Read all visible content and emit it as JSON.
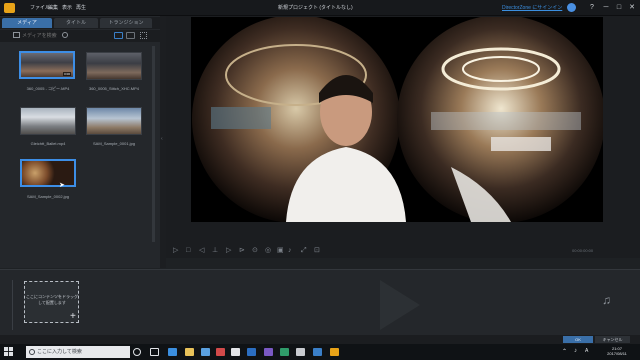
{
  "titlebar": {
    "menus": [
      "ファイル",
      "編集",
      "表示",
      "再生"
    ],
    "title": "新規プロジェクト (タイトルなし)",
    "director_zone": "DirectorZone にサインイン",
    "help": "?",
    "minimize": "─",
    "maximize": "□",
    "close": "✕"
  },
  "tabs": [
    "メディア",
    "タイトル",
    "トランジション"
  ],
  "search": {
    "placeholder": "メディアを検索"
  },
  "media": [
    {
      "label": "360_0005 - コピー.MP4"
    },
    {
      "label": "360_0005_Stitch_XHC.MP4"
    },
    {
      "label": "Gleichtt_Ballet.mp4"
    },
    {
      "label": "SAM_Sample_0001.jpg"
    },
    {
      "label": "SAM_Sample_0002.jpg"
    }
  ],
  "thumb_badge": "0:00",
  "preview": {
    "time": "00:00:00:00"
  },
  "timeline": {
    "drop_label": "ここにコンテンツをドラッグして配置します"
  },
  "bottom": {
    "ok": "OK",
    "cancel": "キャンセル"
  },
  "taskbar": {
    "search_placeholder": "ここに入力して検索",
    "time": "21:07",
    "date": "2017/08/11"
  },
  "colors": {
    "accent": "#3a6fa8",
    "highlight": "#3d8ee6",
    "logo": "#e8a318"
  }
}
